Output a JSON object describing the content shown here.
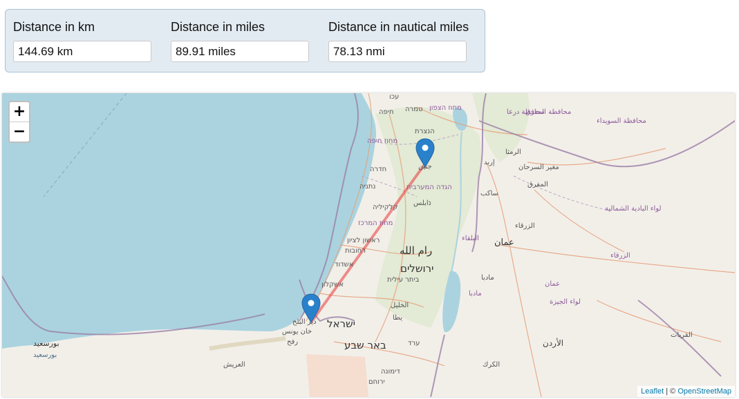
{
  "panel": {
    "fields": [
      {
        "label": "Distance in km",
        "value": "144.69 km"
      },
      {
        "label": "Distance in miles",
        "value": "89.91 miles"
      },
      {
        "label": "Distance in nautical miles",
        "value": "78.13 nmi"
      }
    ]
  },
  "map": {
    "zoom_in": "+",
    "zoom_out": "−",
    "attribution": {
      "leaflet": "Leaflet",
      "separator": " | © ",
      "osm": "OpenStreetMap"
    },
    "line_color": "#e83b3b",
    "marker_color": "#2a81cb",
    "labels": {
      "akko": "עכו",
      "haifa": "חיפה",
      "tamra": "טמרה",
      "north_district": "מחוז הצפון",
      "nazareth": "הנצרת",
      "haifa_district": "מחוז חיפה",
      "jenin": "جنين",
      "hadera": "חדרה",
      "netanya": "נתניה",
      "west_bank": "הגדה המערבית",
      "nablus": "נابلس",
      "qalqilya": "קלקיליה",
      "central_district": "מחוז המרכז",
      "rishon": "ראשון לציון",
      "rehovot": "רחובות",
      "ramallah": "رام الله",
      "ashdod": "אשדוד",
      "jerusalem": "ירושלים",
      "ashkelon": "אשקלון",
      "beitar": "ביתר עילית",
      "hebron": "الخليل",
      "yatta": "يطا",
      "israel": "ישראל",
      "deir_balah": "دير البلح",
      "khan_younis": "خان يونس",
      "rafah": "رفح",
      "beersheba": "באר שבע",
      "arad": "ערד",
      "port_said": "بورسعيد",
      "port_said2": "بورسعيد",
      "arish": "العريش",
      "dimona": "דימונה",
      "yeruham": "ירוחם",
      "daraa_gov": "محافظة درعا",
      "mafraq_gov": "محافظة المفرق",
      "suwayda_gov": "محافظة السويداء",
      "ramtha": "الرمثا",
      "irbid": "إربد",
      "mughayyir": "مغير السرحان",
      "mafraq": "المفرق",
      "sakib": "ساكب",
      "badia": "لواء البادية الشمالية",
      "zarqa": "الزرقاء",
      "balqa": "البلقاء",
      "amman": "عمان",
      "zarqa2": "الزرقاء",
      "madaba": "مادبا",
      "madaba2": "مادبا",
      "amman2": "عمان",
      "jiza": "لواء الجيزة",
      "qurayyat": "القريات",
      "jordan": "الأردن",
      "karak": "الكرك"
    }
  }
}
